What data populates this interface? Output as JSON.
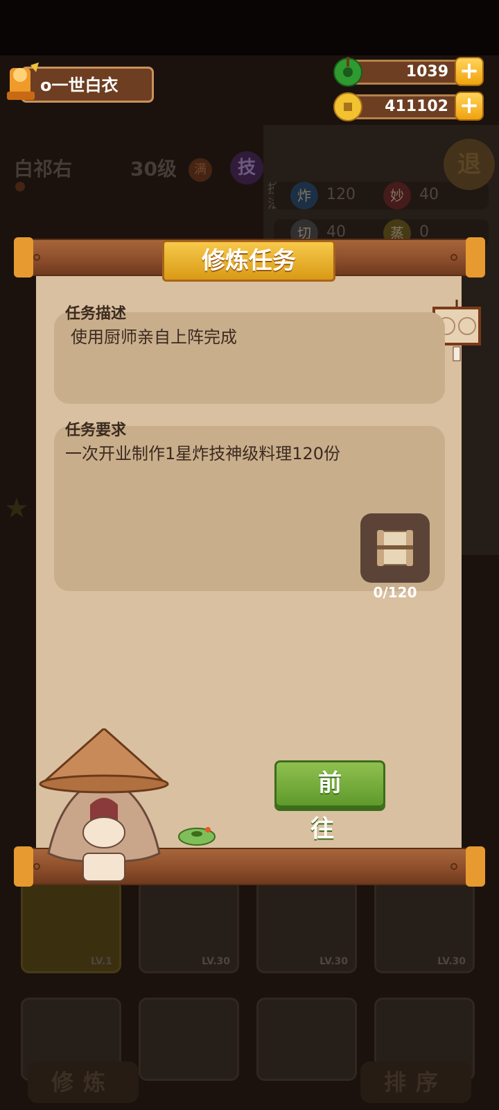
{
  "hud": {
    "player_name": "o一世白衣",
    "jade_amount": "1039",
    "coin_amount": "411102",
    "plus_label": "+"
  },
  "background": {
    "chef_name": "白祁右",
    "chef_level": "30级",
    "max_badge": "满",
    "skill_badge": "技",
    "side_button": "退",
    "stats": [
      {
        "icon": "炸",
        "value": "120"
      },
      {
        "icon": "妙",
        "value": "40"
      },
      {
        "icon": "切",
        "value": "40"
      },
      {
        "icon": "蒸",
        "value": "0"
      }
    ],
    "skill_side_label": "技法",
    "cards_row1_levels": [
      "LV.1",
      "LV.30",
      "LV.30",
      "LV.30"
    ],
    "bottom_left_button": "修炼",
    "bottom_right_button": "排序"
  },
  "dialog": {
    "title": "修炼任务",
    "description_header": "任务描述",
    "description_text": "使用厨师亲自上阵完成",
    "requirement_header": "任务要求",
    "requirement_text": "一次开业制作1星炸技神级料理120份",
    "progress": "0/120",
    "go_button": "前 往"
  },
  "colors": {
    "accent_gold": "#f0a20e",
    "go_green": "#6fa836",
    "paper": "#d9c0a0",
    "wood": "#8a4c2a"
  }
}
